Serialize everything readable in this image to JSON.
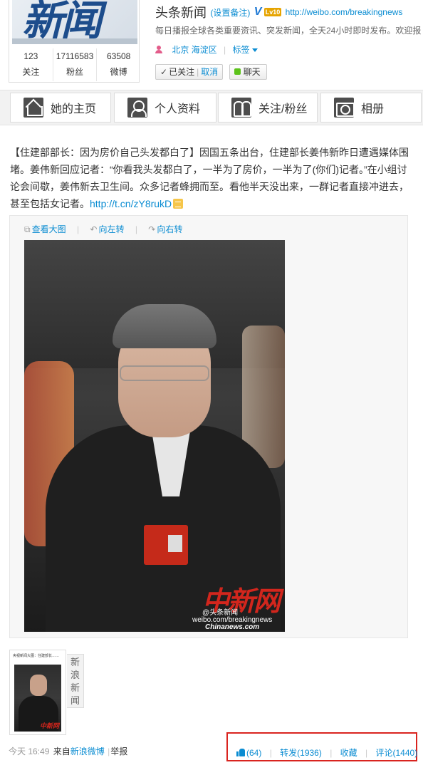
{
  "profile": {
    "name": "头条新闻",
    "set_remark": "(设置备注)",
    "verified_glyph": "V",
    "level_badge": "Lv10",
    "url": "http://weibo.com/breakingnews",
    "description": "每日播报全球各类重要资讯、突发新闻，全天24小时即时发布。欢迎报",
    "location": "北京 海淀区",
    "tags_label": "标签",
    "follow_state": "已关注",
    "unfollow_label": "取消",
    "chat_label": "聊天",
    "avatar_text": "新闻",
    "stats": [
      {
        "num": "123",
        "label": "关注"
      },
      {
        "num": "17116583",
        "label": "粉丝"
      },
      {
        "num": "63508",
        "label": "微博"
      }
    ]
  },
  "nav": {
    "home": "她的主页",
    "info": "个人资料",
    "follow": "关注/粉丝",
    "album": "相册"
  },
  "post": {
    "text": "【住建部部长：因为房价自己头发都白了】因国五条出台，住建部长姜伟新昨日遭遇媒体围堵。姜伟新回应记者：“你看我头发都白了，一半为了房价，一半为了(你们)记者。”在小组讨论会间歇，姜伟新去卫生间。众多记者蜂拥而至。看他半天没出来，一群记者直接冲进去，甚至包括女记者。",
    "link": "http://t.cn/zY8rukD",
    "tools": {
      "view_large": "查看大图",
      "rotate_left": "向左转",
      "rotate_right": "向右转"
    },
    "watermark": {
      "logo": "中新网",
      "handle": "@头条新闻",
      "weibo_url": "weibo.com/breakingnews",
      "domain": "Chinanews.com"
    },
    "source_card": {
      "caption": "央视新闻大图：住建部长……",
      "mini_logo": "中新网",
      "tag": "新浪新闻"
    }
  },
  "footer": {
    "time": "今天 16:49",
    "from_label": "来自",
    "source": "新浪微博",
    "report": "举报",
    "like_count": "(64)",
    "repost": "转发(1936)",
    "favorite": "收藏",
    "comment": "评论(1440)"
  },
  "colors": {
    "link": "#0a8cd2",
    "highlight_border": "#d9241f",
    "brand_blue": "#1d4d8c"
  }
}
